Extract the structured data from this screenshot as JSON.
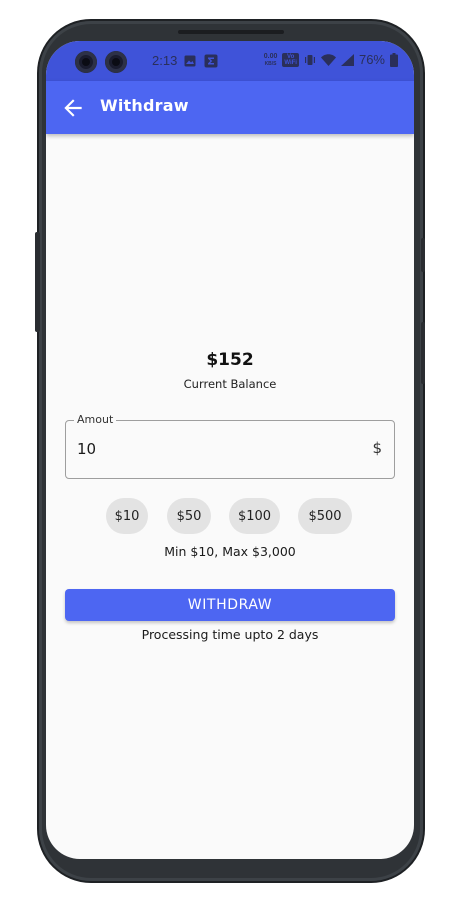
{
  "status_bar": {
    "time": "2:13",
    "data_speed_value": "0.00",
    "data_speed_unit": "KB/S",
    "wifi_badge_top": "Vo",
    "wifi_badge_bottom": "WiFi",
    "battery": "76%"
  },
  "app_bar": {
    "title": "Withdraw",
    "background": "#4d66f2"
  },
  "balance": {
    "amount": "$152",
    "label": "Current Balance"
  },
  "amount_field": {
    "label": "Amout",
    "value": "10",
    "suffix": "$"
  },
  "quick_amounts": [
    "$10",
    "$50",
    "$100",
    "$500"
  ],
  "limits_text": "Min $10, Max $3,000",
  "withdraw_button": {
    "label": "WITHDRAW",
    "color": "#4d66f2"
  },
  "processing_text": "Processing time upto 2 days",
  "icons": {
    "back": "arrow-back-icon",
    "gallery": "image-icon",
    "sigma": "sigma-icon",
    "vibrate": "vibrate-icon",
    "wifi": "wifi-icon",
    "signal": "cell-signal-icon",
    "battery": "battery-icon"
  }
}
